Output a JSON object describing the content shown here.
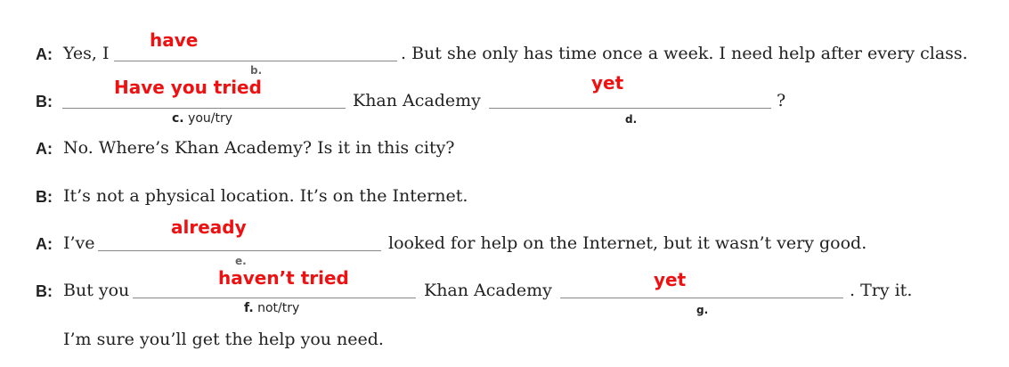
{
  "line1": {
    "speaker": "A:",
    "text_before": "Yes, I",
    "answer": "have",
    "text_after": ". But she only has time once a week. I need help after every class."
  },
  "line2": {
    "speaker": "B:",
    "answer_c": "Have you tried",
    "label_b": "b.",
    "label_c_letter": "c.",
    "label_c_verb": "you/try",
    "text_mid": "Khan Academy",
    "answer_d": "yet",
    "label_d": "d.",
    "text_end": "?"
  },
  "line3": {
    "speaker": "A:",
    "text": "No. Where’s Khan Academy? Is it in this city?"
  },
  "line4": {
    "speaker": "B:",
    "text": "It’s not a physical location. It’s on the Internet."
  },
  "line5": {
    "speaker": "A:",
    "text_before": "I’ve",
    "answer": "already",
    "label_e": "e.",
    "text_after": "looked for help on the Internet, but it wasn’t very good."
  },
  "line6": {
    "speaker": "B:",
    "text_before": "But you",
    "answer_f": "haven’t tried",
    "label_f_letter": "f.",
    "label_f_verb": "not/try",
    "text_mid": "Khan Academy",
    "answer_g": "yet",
    "label_g": "g.",
    "text_end": ". Try it."
  },
  "line7": {
    "text": "I’m sure you’ll get the help you need."
  }
}
